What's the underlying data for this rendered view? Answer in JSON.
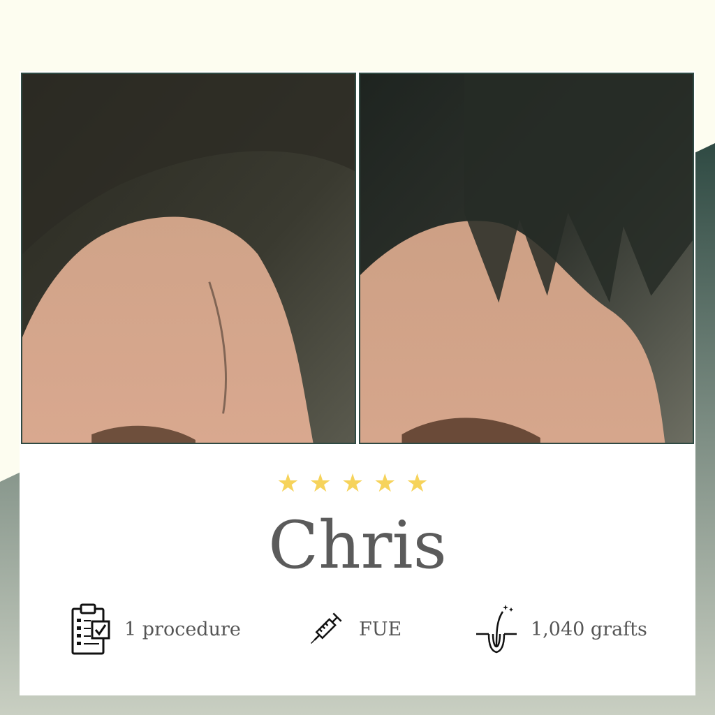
{
  "colors": {
    "background": "#fdfdf0",
    "accent_dark": "#2f4a43",
    "star": "#f6d35b",
    "name_text": "#5b5b5b"
  },
  "photos": {
    "before_alt": "",
    "after_alt": ""
  },
  "rating": {
    "stars": 5,
    "glyph": "★"
  },
  "patient": {
    "name": "Chris"
  },
  "stats": [
    {
      "icon": "clipboard-checklist-icon",
      "label": "1 procedure"
    },
    {
      "icon": "syringe-icon",
      "label": "FUE"
    },
    {
      "icon": "hair-follicle-icon",
      "label": "1,040 grafts"
    }
  ]
}
